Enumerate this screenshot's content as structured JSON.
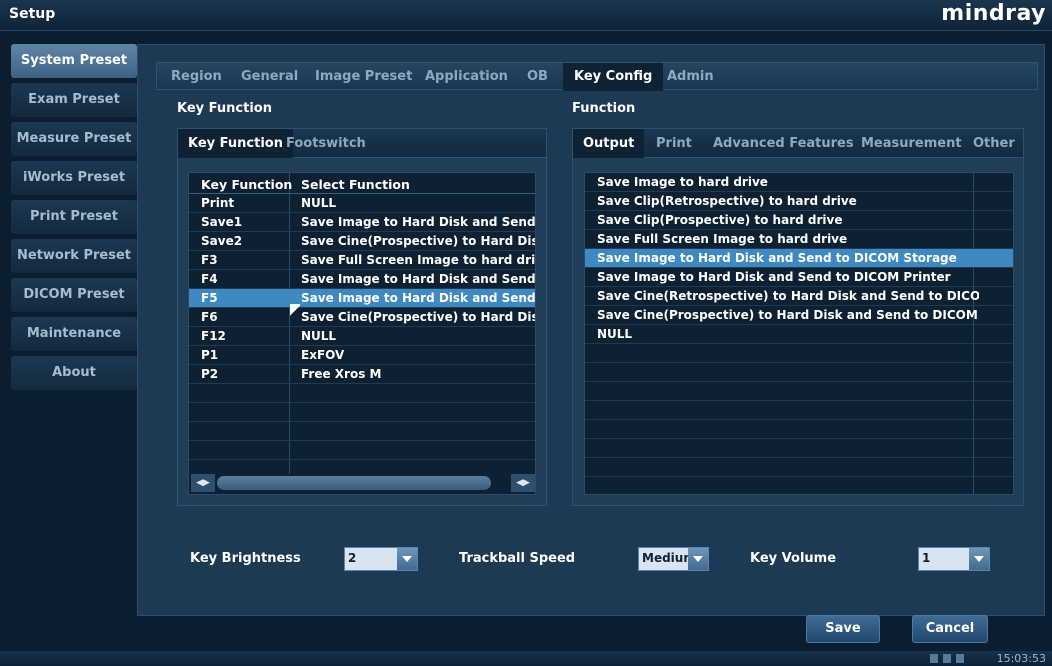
{
  "window": {
    "title": "Setup",
    "brand": "mindray"
  },
  "nav": {
    "items": [
      {
        "label": "System Preset",
        "active": true
      },
      {
        "label": "Exam Preset"
      },
      {
        "label": "Measure Preset"
      },
      {
        "label": "iWorks Preset"
      },
      {
        "label": "Print Preset"
      },
      {
        "label": "Network Preset"
      },
      {
        "label": "DICOM Preset"
      },
      {
        "label": "Maintenance"
      },
      {
        "label": "About"
      }
    ]
  },
  "top_tabs": [
    {
      "label": "Region"
    },
    {
      "label": "General"
    },
    {
      "label": "Image Preset"
    },
    {
      "label": "Application"
    },
    {
      "label": "OB"
    },
    {
      "label": "Key Config",
      "active": true
    },
    {
      "label": "Admin"
    }
  ],
  "key_function": {
    "section_label": "Key Function",
    "tabs": [
      {
        "label": "Key Function",
        "active": true
      },
      {
        "label": "Footswitch"
      }
    ],
    "columns": [
      "Key Function",
      "Select Function"
    ],
    "rows": [
      {
        "key": "Print",
        "function": "NULL"
      },
      {
        "key": "Save1",
        "function": "Save Image to Hard Disk and Send to"
      },
      {
        "key": "Save2",
        "function": "Save Cine(Prospective)  to Hard Disk"
      },
      {
        "key": "F3",
        "function": "Save Full Screen Image to hard drive"
      },
      {
        "key": "F4",
        "function": "Save Image to Hard Disk and Send to"
      },
      {
        "key": "F5",
        "function": "Save Image to Hard Disk and Send to",
        "selected": true
      },
      {
        "key": "F6",
        "function": "Save Cine(Prospective)  to Hard Disk"
      },
      {
        "key": "F12",
        "function": "NULL"
      },
      {
        "key": "P1",
        "function": "ExFOV"
      },
      {
        "key": "P2",
        "function": "Free Xros M"
      }
    ]
  },
  "function_panel": {
    "section_label": "Function",
    "tabs": [
      {
        "label": "Output",
        "active": true
      },
      {
        "label": "Print"
      },
      {
        "label": "Advanced Features"
      },
      {
        "label": "Measurement"
      },
      {
        "label": "Other"
      }
    ],
    "items": [
      {
        "label": "Save Image to hard drive"
      },
      {
        "label": "Save Clip(Retrospective) to hard drive"
      },
      {
        "label": "Save Clip(Prospective) to hard drive"
      },
      {
        "label": "Save Full Screen Image to hard drive"
      },
      {
        "label": "Save Image to Hard Disk and Send to DICOM Storage",
        "selected": true
      },
      {
        "label": "Save Image to Hard Disk and Send to DICOM Printer"
      },
      {
        "label": "Save Cine(Retrospective) to Hard Disk and Send to DICOM..."
      },
      {
        "label": "Save Cine(Prospective)  to Hard Disk and Send to DICOM ..."
      },
      {
        "label": "NULL"
      }
    ]
  },
  "settings": {
    "key_brightness": {
      "label": "Key Brightness",
      "value": "2"
    },
    "trackball_speed": {
      "label": "Trackball Speed",
      "value": "Medium"
    },
    "key_volume": {
      "label": "Key Volume",
      "value": "1"
    }
  },
  "buttons": {
    "save": "Save",
    "cancel": "Cancel"
  },
  "status": {
    "time": "15:03:53"
  },
  "colors": {
    "accent": "#3f89c2",
    "background": "#0b1a2a",
    "panel": "#1d3a54"
  }
}
